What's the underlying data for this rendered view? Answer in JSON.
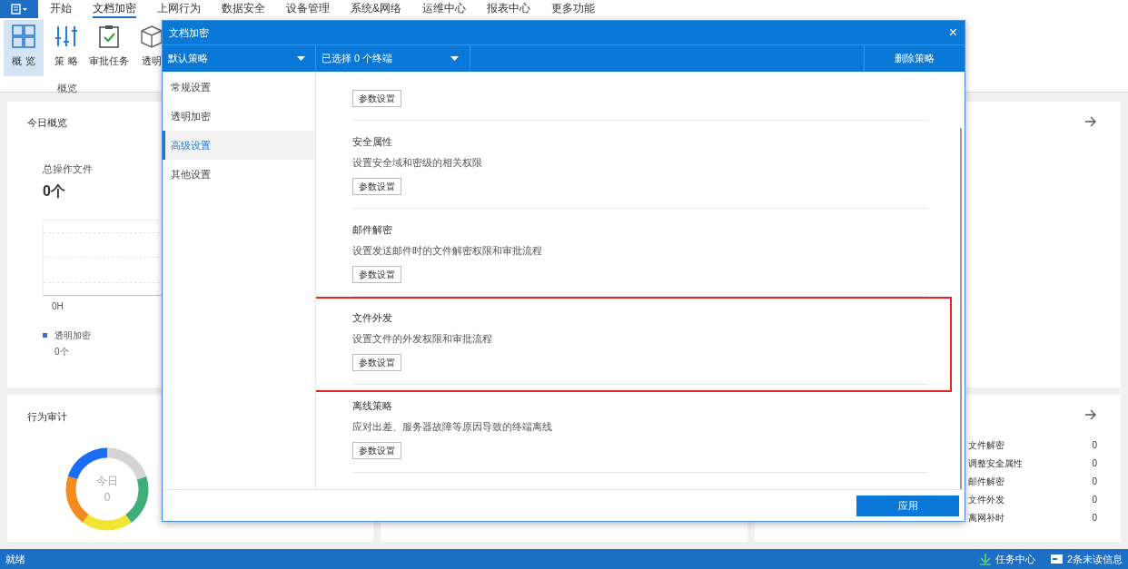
{
  "menu_bar": {
    "tabs": [
      {
        "label": "开始",
        "selected": false
      },
      {
        "label": "文档加密",
        "selected": true
      },
      {
        "label": "上网行为",
        "selected": false
      },
      {
        "label": "数据安全",
        "selected": false
      },
      {
        "label": "设备管理",
        "selected": false
      },
      {
        "label": "系统&网络",
        "selected": false
      },
      {
        "label": "运维中心",
        "selected": false
      },
      {
        "label": "报表中心",
        "selected": false
      },
      {
        "label": "更多功能",
        "selected": false
      }
    ]
  },
  "ribbon": {
    "buttons": [
      {
        "kind": "overview",
        "label": "概 览",
        "selected": true
      },
      {
        "kind": "policy",
        "label": "策 略",
        "selected": false
      },
      {
        "kind": "approval",
        "label": "审批任务",
        "selected": false
      },
      {
        "kind": "cube",
        "label": "透明",
        "selected": false
      }
    ],
    "group_label": "概览"
  },
  "today_card": {
    "title": "今日概览",
    "metric_label": "总操作文件",
    "metric_value": "0个",
    "axis_label": "0H",
    "legend": [
      {
        "label": "透明加密",
        "value": "0个",
        "color": "#2f6fe0"
      }
    ]
  },
  "audit_card": {
    "title": "行为审计",
    "center_label": "今日",
    "center_value": "0"
  },
  "stats_card": {
    "rows": [
      {
        "label": "文件解密",
        "value": "0"
      },
      {
        "label": "调整安全属性",
        "value": "0"
      },
      {
        "label": "邮件解密",
        "value": "0"
      },
      {
        "label": "文件外发",
        "value": "0"
      },
      {
        "label": "离网补时",
        "value": "0"
      }
    ]
  },
  "dialog": {
    "title": "文档加密",
    "close": "×",
    "policy_dropdown": "默认策略",
    "terminal_dropdown": "已选择 0 个终端",
    "delete_button": "删除策略",
    "sidebar": [
      {
        "label": "常规设置",
        "selected": false
      },
      {
        "label": "透明加密",
        "selected": false
      },
      {
        "label": "高级设置",
        "selected": true
      },
      {
        "label": "其他设置",
        "selected": false
      }
    ],
    "sections": [
      {
        "button": "参数设置",
        "highlighted": false
      },
      {
        "title": "安全属性",
        "description": "设置安全域和密级的相关权限",
        "button": "参数设置",
        "highlighted": false
      },
      {
        "title": "邮件解密",
        "description": "设置发送邮件时的文件解密权限和审批流程",
        "button": "参数设置",
        "highlighted": false
      },
      {
        "title": "文件外发",
        "description": "设置文件的外发权限和审批流程",
        "button": "参数设置",
        "highlighted": true
      },
      {
        "title": "离线策略",
        "description": "应对出差、服务器故障等原因导致的终端离线",
        "button": "参数设置",
        "highlighted": false
      }
    ],
    "apply_button": "应用"
  },
  "status_bar": {
    "status": "就绪",
    "task_center": "任务中心",
    "messages": "2条未读信息"
  }
}
